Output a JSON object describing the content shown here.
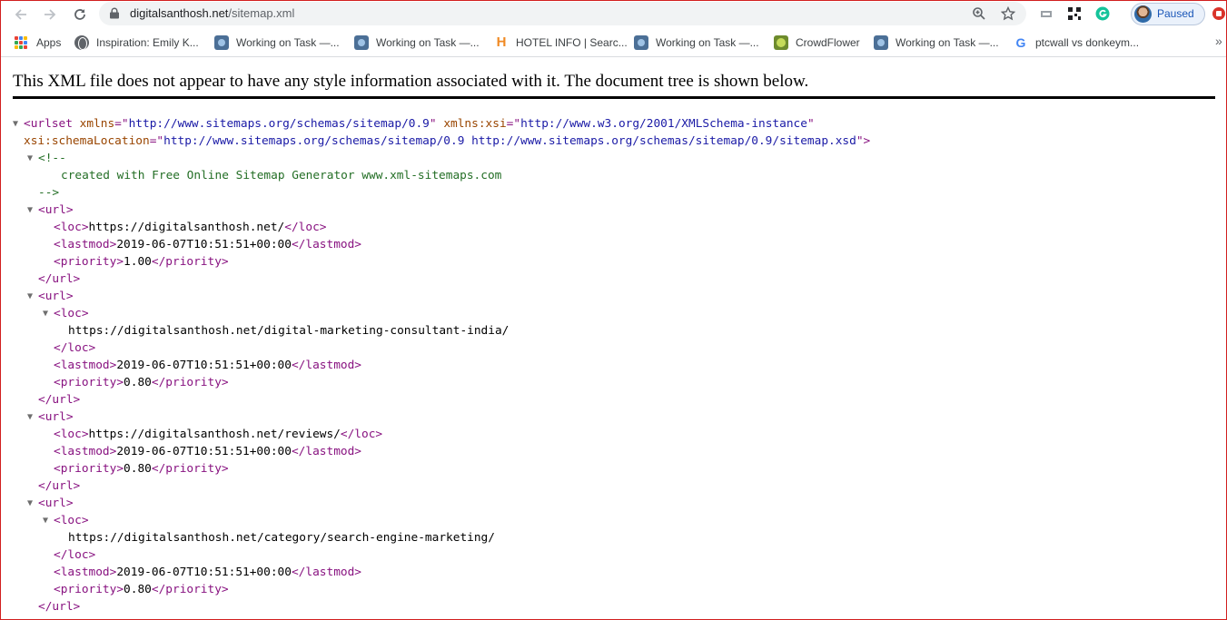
{
  "browser": {
    "url_host": "digitalsanthosh.net",
    "url_path": "/sitemap.xml",
    "profile_status": "Paused"
  },
  "bookmarks": [
    {
      "label": "Apps",
      "icon": "apps-grid-icon"
    },
    {
      "label": "Inspiration: Emily K...",
      "icon": "globe-icon"
    },
    {
      "label": "Working on Task —...",
      "icon": "task-icon"
    },
    {
      "label": "Working on Task —...",
      "icon": "task-icon"
    },
    {
      "label": "HOTEL INFO | Searc...",
      "icon": "hotel-icon"
    },
    {
      "label": "Working on Task —...",
      "icon": "task-icon"
    },
    {
      "label": "CrowdFlower",
      "icon": "crowdflower-icon"
    },
    {
      "label": "Working on Task —...",
      "icon": "task-icon"
    },
    {
      "label": "ptcwall vs donkeym...",
      "icon": "google-icon"
    }
  ],
  "bookmarks_more": "»",
  "document": {
    "notice": "This XML file does not appear to have any style information associated with it. The document tree is shown below.",
    "xmlns": "http://www.sitemaps.org/schemas/sitemap/0.9",
    "xmlns_xsi": "http://www.w3.org/2001/XMLSchema-instance",
    "schema_location": "http://www.sitemaps.org/schemas/sitemap/0.9 http://www.sitemaps.org/schemas/sitemap/0.9/sitemap.xsd",
    "comment": "created with Free Online Sitemap Generator www.xml-sitemaps.com",
    "urls": [
      {
        "loc": "https://digitalsanthosh.net/",
        "lastmod": "2019-06-07T10:51:51+00:00",
        "priority": "1.00",
        "loc_expanded": false
      },
      {
        "loc": "https://digitalsanthosh.net/digital-marketing-consultant-india/",
        "lastmod": "2019-06-07T10:51:51+00:00",
        "priority": "0.80",
        "loc_expanded": true
      },
      {
        "loc": "https://digitalsanthosh.net/reviews/",
        "lastmod": "2019-06-07T10:51:51+00:00",
        "priority": "0.80",
        "loc_expanded": false
      },
      {
        "loc": "https://digitalsanthosh.net/category/search-engine-marketing/",
        "lastmod": "2019-06-07T10:51:51+00:00",
        "priority": "0.80",
        "loc_expanded": true
      }
    ]
  }
}
